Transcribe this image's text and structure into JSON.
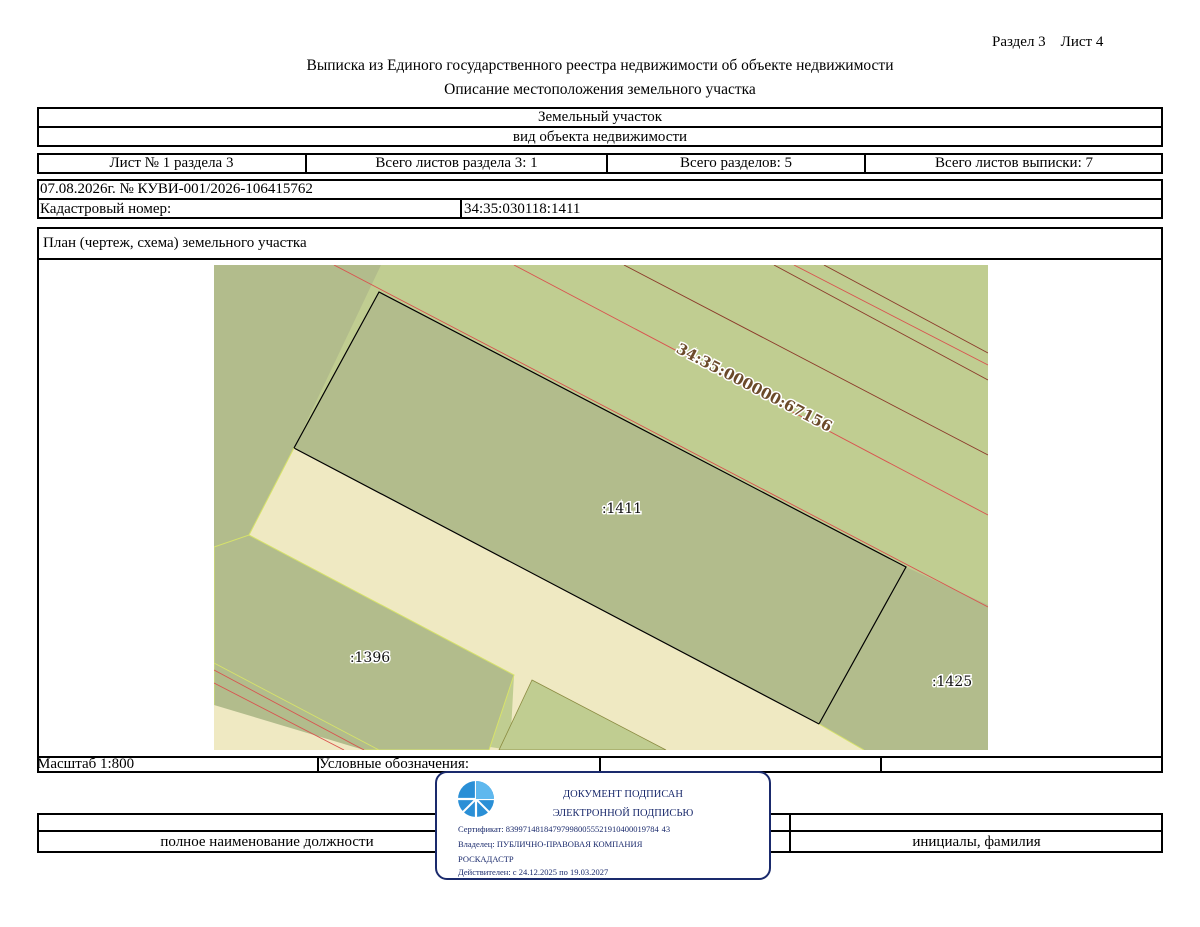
{
  "header": {
    "section_ref": "Раздел 3    Лист 4",
    "title": "Выписка из Единого государственного реестра недвижимости об объекте недвижимости",
    "subtitle": "Описание местоположения земельного участка"
  },
  "object": {
    "type": "Земельный участок",
    "type_caption": "вид объекта недвижимости"
  },
  "sheets": {
    "sheet_no": "Лист № 1 раздела 3",
    "total_sheets_section": "Всего листов раздела 3: 1",
    "total_sections": "Всего разделов: 5",
    "total_sheets_extract": "Всего листов выписки: 7"
  },
  "record": {
    "date_number": "07.08.2026г. № КУВИ-001/2026-106415762",
    "cadastral_label": "Кадастровый номер:",
    "cadastral_value": "34:35:030118:1411"
  },
  "plan": {
    "title": "План (чертеж, схема) земельного участка",
    "labels": {
      "main": ":1411",
      "left": ":1396",
      "right": ":1425",
      "road": "34:35:000000:67156"
    },
    "colors": {
      "parcel_main": "#b2bc8c",
      "parcel_light": "#c0cd91",
      "road_fill": "#efe9c2",
      "red_line": "#d9534f"
    }
  },
  "footer": {
    "scale": "Масштаб 1:800",
    "legend": "Условные обозначения:",
    "position_caption": "полное наименование должности",
    "signature_caption": "инициалы, фамилия"
  },
  "stamp": {
    "line1": "ДОКУМЕНТ ПОДПИСАН",
    "line2": "ЭЛЕКТРОННОЙ ПОДПИСЬЮ",
    "certificate": "Сертификат: 839971481847979980055521910400019784 43",
    "owner1": "Владелец: ПУБЛИЧНО-ПРАВОВАЯ КОМПАНИЯ",
    "owner2": "РОСКАДАСТР",
    "valid": "Действителен: с 24.12.2025 по 19.03.2027",
    "logo_icon": "roskadastr-logo-icon"
  }
}
